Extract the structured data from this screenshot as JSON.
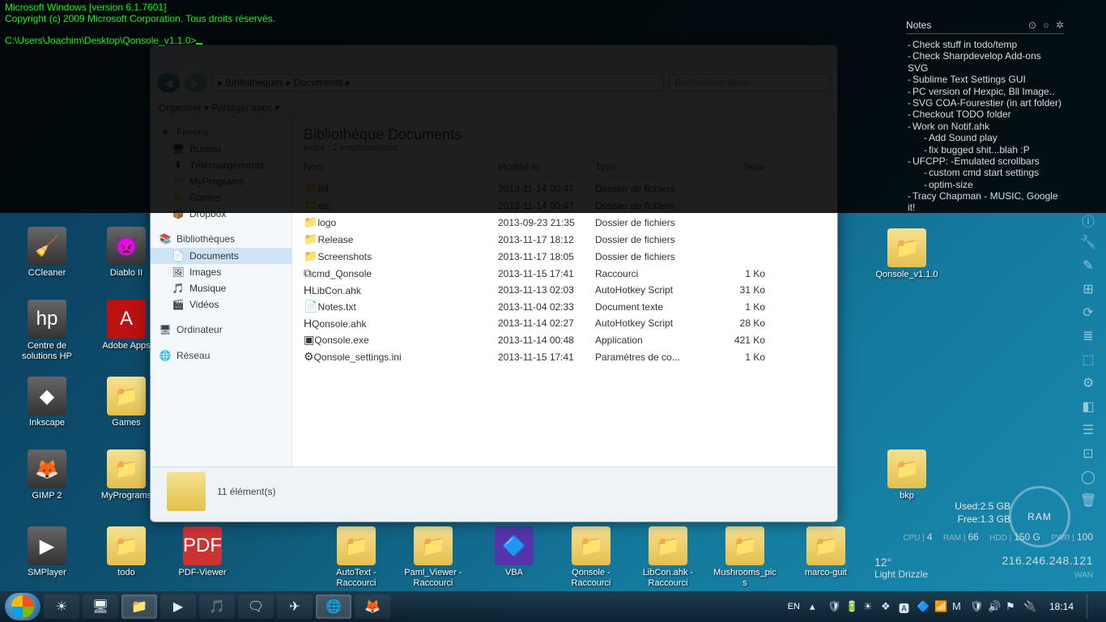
{
  "console": {
    "line1": "Microsoft Windows [version 6.1.7601]",
    "line2": "Copyright (c) 2009 Microsoft Corporation. Tous droits réservés.",
    "prompt": "C:\\Users\\Joachim\\Desktop\\Qonsole_v1.1.0>"
  },
  "desktop_icons_left": [
    {
      "label": "CCleaner",
      "glyph": "🧹",
      "type": "app"
    },
    {
      "label": "Diablo II",
      "glyph": "👿",
      "type": "app"
    },
    {
      "label": "Centre de solutions HP",
      "glyph": "🖨",
      "type": "app"
    },
    {
      "label": "Adobe Apps",
      "glyph": "A",
      "type": "app"
    },
    {
      "label": "Inkscape",
      "glyph": "◆",
      "type": "app"
    },
    {
      "label": "Games",
      "glyph": "📁",
      "type": "folder"
    },
    {
      "label": "GIMP 2",
      "glyph": "🦊",
      "type": "app"
    },
    {
      "label": "MyPrograms",
      "glyph": "📁",
      "type": "folder"
    },
    {
      "label": "SMPlayer",
      "glyph": "▶",
      "type": "app"
    },
    {
      "label": "todo",
      "glyph": "📁",
      "type": "folder"
    },
    {
      "label": "PDF-Viewer",
      "glyph": "📄",
      "type": "app"
    }
  ],
  "desktop_icons_bottom": [
    {
      "label": "AutoText - Raccourci",
      "glyph": "📁"
    },
    {
      "label": "Paml_Viewer - Raccourci",
      "glyph": "📁"
    },
    {
      "label": "VBA",
      "glyph": "🔷"
    },
    {
      "label": "Qonsole - Raccourci",
      "glyph": "📁"
    },
    {
      "label": "LibCon.ahk - Raccourci",
      "glyph": "📁"
    },
    {
      "label": "Mushrooms_pics",
      "glyph": "📁"
    },
    {
      "label": "marco-guit",
      "glyph": "📁"
    }
  ],
  "desktop_icons_right": [
    {
      "label": "Qonsole_v1.1.0",
      "glyph": "📁"
    },
    {
      "label": "bkp",
      "glyph": "📁"
    }
  ],
  "explorer": {
    "address": "▸ Bibliothèques ▸ Documents ▸",
    "search_placeholder": "Rechercher dans : ...",
    "toolbar": "Organiser ▾    Partager avec ▾",
    "lib_title": "Bibliothèque Documents",
    "lib_sub": "Inclut : 2 emplacements",
    "cols": {
      "name": "Nom",
      "date": "Modifié le",
      "type": "Type",
      "size": "Taille"
    },
    "sidebar": {
      "fav": "Favoris",
      "fav_items": [
        "Bureau",
        "Téléchargements",
        "MyPrograms",
        "Games",
        "Dropbox"
      ],
      "lib": "Bibliothèques",
      "lib_items": [
        "Documents",
        "Images",
        "Musique",
        "Vidéos"
      ],
      "computer": "Ordinateur",
      "network": "Réseau"
    },
    "files": [
      {
        "ic": "📁",
        "name": "Bll",
        "date": "2013-11-14 00:47",
        "type": "Dossier de fichiers",
        "size": ""
      },
      {
        "ic": "📁",
        "name": "etc",
        "date": "2013-11-14 00:47",
        "type": "Dossier de fichiers",
        "size": ""
      },
      {
        "ic": "📁",
        "name": "logo",
        "date": "2013-09-23 21:35",
        "type": "Dossier de fichiers",
        "size": ""
      },
      {
        "ic": "📁",
        "name": "Release",
        "date": "2013-11-17 18:12",
        "type": "Dossier de fichiers",
        "size": ""
      },
      {
        "ic": "📁",
        "name": "Screenshots",
        "date": "2013-11-17 18:05",
        "type": "Dossier de fichiers",
        "size": ""
      },
      {
        "ic": "⧉",
        "name": "cmd_Qonsole",
        "date": "2013-11-15 17:41",
        "type": "Raccourci",
        "size": "1 Ko"
      },
      {
        "ic": "H",
        "name": "LibCon.ahk",
        "date": "2013-11-13 02:03",
        "type": "AutoHotkey Script",
        "size": "31 Ko"
      },
      {
        "ic": "📄",
        "name": "Notes.txt",
        "date": "2013-11-04 02:33",
        "type": "Document texte",
        "size": "1 Ko"
      },
      {
        "ic": "H",
        "name": "Qonsole.ahk",
        "date": "2013-11-14 02:27",
        "type": "AutoHotkey Script",
        "size": "28 Ko"
      },
      {
        "ic": "▣",
        "name": "Qonsole.exe",
        "date": "2013-11-14 00:48",
        "type": "Application",
        "size": "421 Ko"
      },
      {
        "ic": "⚙",
        "name": "Qonsole_settings.ini",
        "date": "2013-11-15 17:41",
        "type": "Paramètres de co...",
        "size": "1 Ko"
      }
    ],
    "status": "11 élément(s)"
  },
  "notes": {
    "title": "Notes",
    "items": [
      {
        "t": "Check stuff in todo/temp"
      },
      {
        "t": "Check Sharpdevelop Add-ons SVG"
      },
      {
        "t": "Sublime Text Settings GUI"
      },
      {
        "t": "PC version of Hexpic, Bll Image.."
      },
      {
        "t": "SVG COA-Fourestier (in art folder)"
      },
      {
        "t": "Checkout TODO folder"
      },
      {
        "t": "Work on Notif.ahk"
      },
      {
        "t": "Add Sound play",
        "indent": true
      },
      {
        "t": "fix bugged shit...blah :P",
        "indent": true
      },
      {
        "t": "UFCPP:  -Emulated scrollbars"
      },
      {
        "t": "custom cmd start settings",
        "indent": true
      },
      {
        "t": "optim-size",
        "indent": true
      },
      {
        "t": "Tracy Chapman - MUSIC, Google it!"
      }
    ]
  },
  "ram": {
    "label": "RAM",
    "used": "Used:2.5 GB",
    "free": "Free:1.3 GB"
  },
  "sysmon": {
    "cpu_l": "CPU |",
    "cpu_v": "4",
    "ram_l": "RAM |",
    "ram_v": "66",
    "hdd_l": "HDD |",
    "hdd_v": "150 G",
    "pwr_l": "PWR |",
    "pwr_v": "100",
    "ip": "216.246.248.121",
    "wan": "WAN"
  },
  "weather": {
    "temp": "12°",
    "cond": "Light Drizzle"
  },
  "taskbar": {
    "buttons": [
      {
        "glyph": "☀",
        "name": "weather"
      },
      {
        "glyph": "🖥",
        "name": "desktop-toggle"
      },
      {
        "glyph": "📁",
        "name": "explorer",
        "active": true
      },
      {
        "glyph": "▶",
        "name": "media-player"
      },
      {
        "glyph": "🎵",
        "name": "itunes"
      },
      {
        "glyph": "🗨",
        "name": "chat"
      },
      {
        "glyph": "✈",
        "name": "launcher"
      },
      {
        "glyph": "🌐",
        "name": "chrome",
        "active": true
      },
      {
        "glyph": "🦊",
        "name": "firefox"
      }
    ],
    "lang": "EN",
    "tray_icons": [
      "▴",
      "🛡",
      "🔋",
      "☀",
      "❖",
      "🅰",
      "🔷",
      "📶",
      "M",
      "🛡",
      "🔊",
      "⚑",
      "🔌"
    ],
    "clock": "18:14"
  }
}
